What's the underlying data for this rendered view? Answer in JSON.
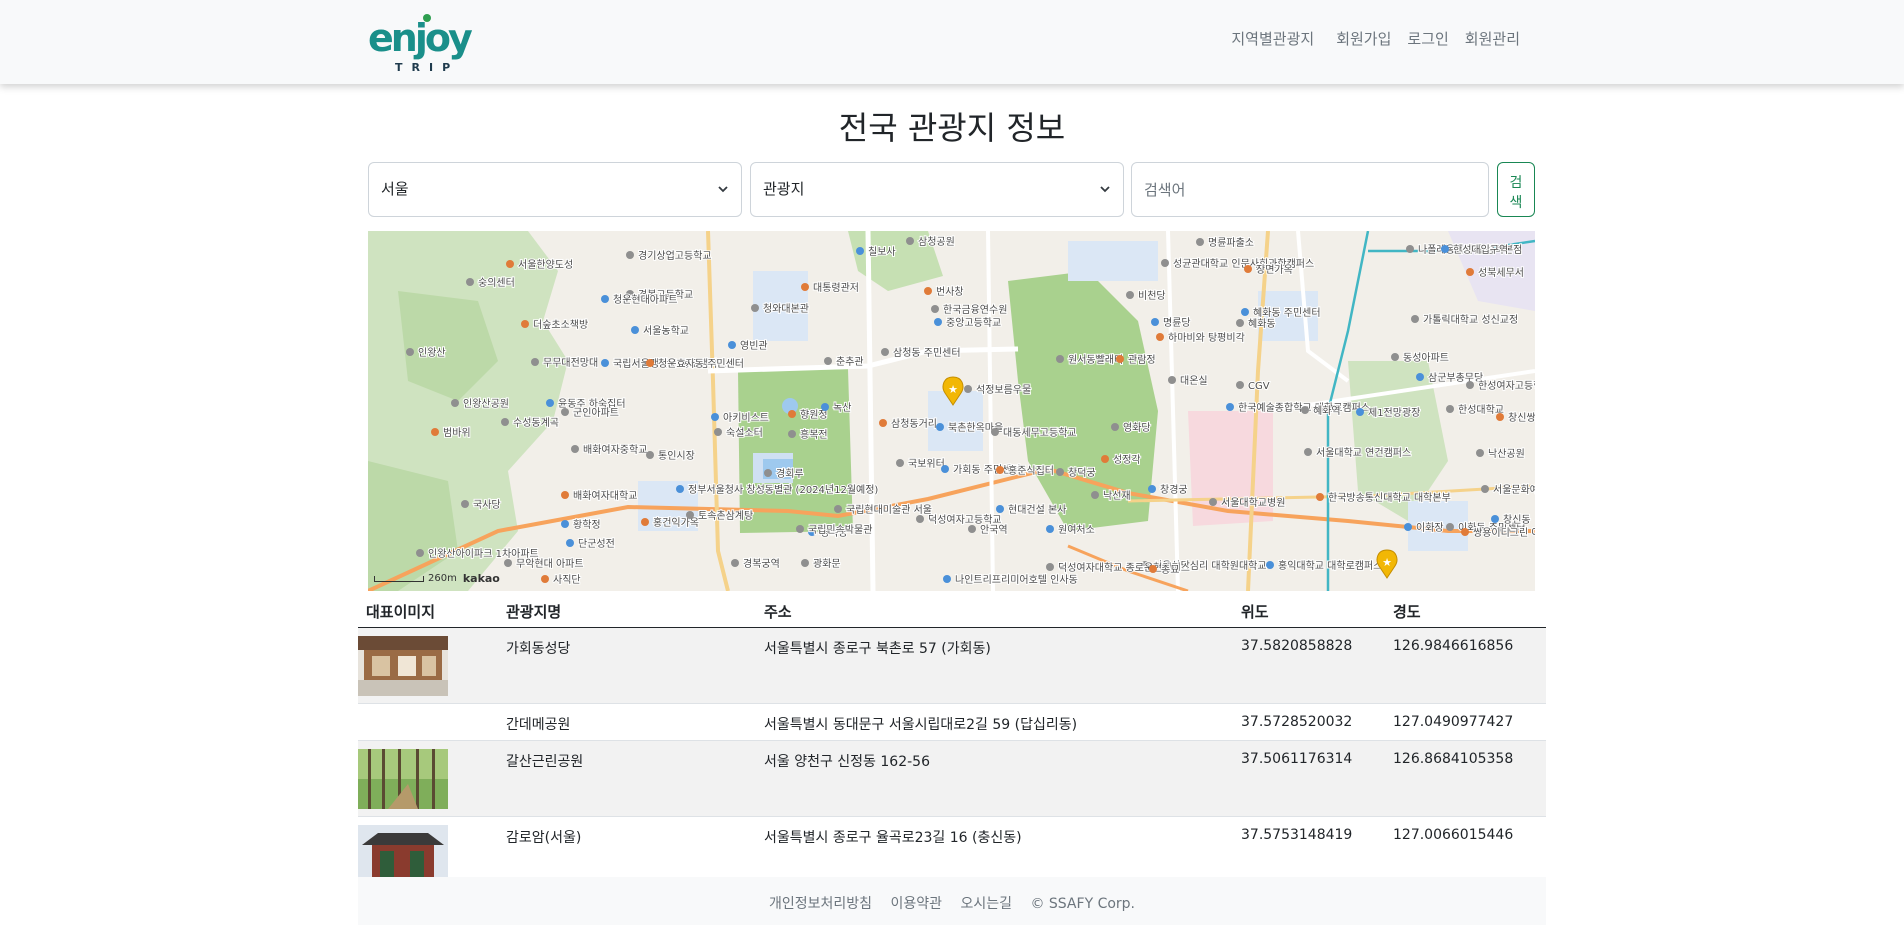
{
  "header": {
    "logo_text": "enjoy",
    "logo_sub": "TRIP",
    "nav": [
      "지역별관광지",
      "회원가입",
      "로그인",
      "회원관리"
    ]
  },
  "page_title": "전국 관광지 정보",
  "search": {
    "region_value": "서울",
    "type_value": "관광지",
    "keyword_placeholder": "검색어",
    "button_label": "검색"
  },
  "map": {
    "scale_label": "260m",
    "provider": "kakao",
    "labels": [
      "서울한양도성",
      "경기상업고등학교",
      "경복고등학교",
      "청운현대아파트",
      "숭의센터",
      "더숲초소책방",
      "서울농학교",
      "인왕산",
      "무무대전망대",
      "국립서울맹학교 종로캠퍼스",
      "청운효자동 주민센터",
      "인왕산공원",
      "윤동주 하숙집터",
      "군인아파트",
      "수성동계곡",
      "범바위",
      "배화여자중학교",
      "통인시장",
      "아키비스트",
      "숙설소터",
      "배화여자대학교",
      "정부서울청사 창성동별관 (2024년12월예정)",
      "경회루",
      "국사당",
      "황학정",
      "홍건익가옥",
      "토속촌삼계탕",
      "단군성전",
      "인왕산아이파크 1차아파트",
      "무악현대 아파트",
      "사직단",
      "경복궁역",
      "광화문",
      "경복궁",
      "국립민속박물관",
      "향원정",
      "녹산",
      "흥복전",
      "국립현대미술관 서울",
      "칠보사",
      "대통령관저",
      "청와대본관",
      "영빈관",
      "춘추관",
      "삼청공원",
      "번사창",
      "한국금융연수원",
      "삼청동 주민센터",
      "중앙고등학교",
      "석정보름우물",
      "삼청동거리",
      "북촌한옥마을",
      "대동세무고등학교",
      "국보위터",
      "가회동 주민센터",
      "홍준식집터",
      "덕성여자고등학교",
      "현대건설 본사",
      "안국역",
      "원서동빨래터",
      "관람정",
      "창덕궁",
      "낙선재",
      "원여처소",
      "영화당",
      "성정각",
      "창경궁",
      "성균관대학교 인문사회과학캠퍼스",
      "비천당",
      "명륜당",
      "하마비와 탕평비각",
      "대온실",
      "한국예술종합학교 대학로캠퍼스",
      "서울대학교병원",
      "서울대학교 연건캠퍼스",
      "한국방송통신대학교 대학본부",
      "CGV",
      "혜화역",
      "제1전망광장",
      "명륜파출소",
      "장면가옥",
      "혜화동 주민센터",
      "나폴레옹과자점 성북본점",
      "가톨릭대학교 성신교정",
      "한성대입구역",
      "성북세무서",
      "동성아파트",
      "삼군부총무당",
      "한성여자고등학교",
      "한성대학교",
      "창신쌍용 아파트",
      "낙산공원",
      "서울문화예술 고등학교",
      "이화장",
      "이화동 주민센터",
      "쌍용이디그린 아파트",
      "홍익대학교 대학로캠퍼스",
      "서울상담심리 대학원대학교",
      "덕성여자대학교 종로운현캠퍼스",
      "나인트리프리미어호텔 인사동",
      "종묘",
      "혜화동",
      "창신동"
    ]
  },
  "table": {
    "headers": [
      "대표이미지",
      "관광지명",
      "주소",
      "위도",
      "경도"
    ],
    "rows": [
      {
        "name": "가회동성당",
        "address": "서울특별시 종로구 북촌로 57 (가회동)",
        "lat": "37.5820858828",
        "lng": "126.9846616856",
        "has_image": true
      },
      {
        "name": "간데메공원",
        "address": "서울특별시 동대문구 서울시립대로2길 59 (답십리동)",
        "lat": "37.5728520032",
        "lng": "127.0490977427",
        "has_image": false
      },
      {
        "name": "갈산근린공원",
        "address": "서울 양천구 신정동 162-56",
        "lat": "37.5061176314",
        "lng": "126.8684105358",
        "has_image": true
      },
      {
        "name": "감로암(서울)",
        "address": "서울특별시 종로구 율곡로23길 16 (충신동)",
        "lat": "37.5753148419",
        "lng": "127.0066015446",
        "has_image": true
      }
    ]
  },
  "footer": {
    "links": [
      "개인정보처리방침",
      "이용약관",
      "오시는길"
    ],
    "copyright": "© SSAFY Corp."
  },
  "colors": {
    "accent": "#198754",
    "logo_teal": "#1a8f8a",
    "logo_green": "#2e9e4f",
    "nav_bg": "#f8f9fa",
    "map_park": "#b5d89c",
    "map_marker": "#f2b705"
  }
}
